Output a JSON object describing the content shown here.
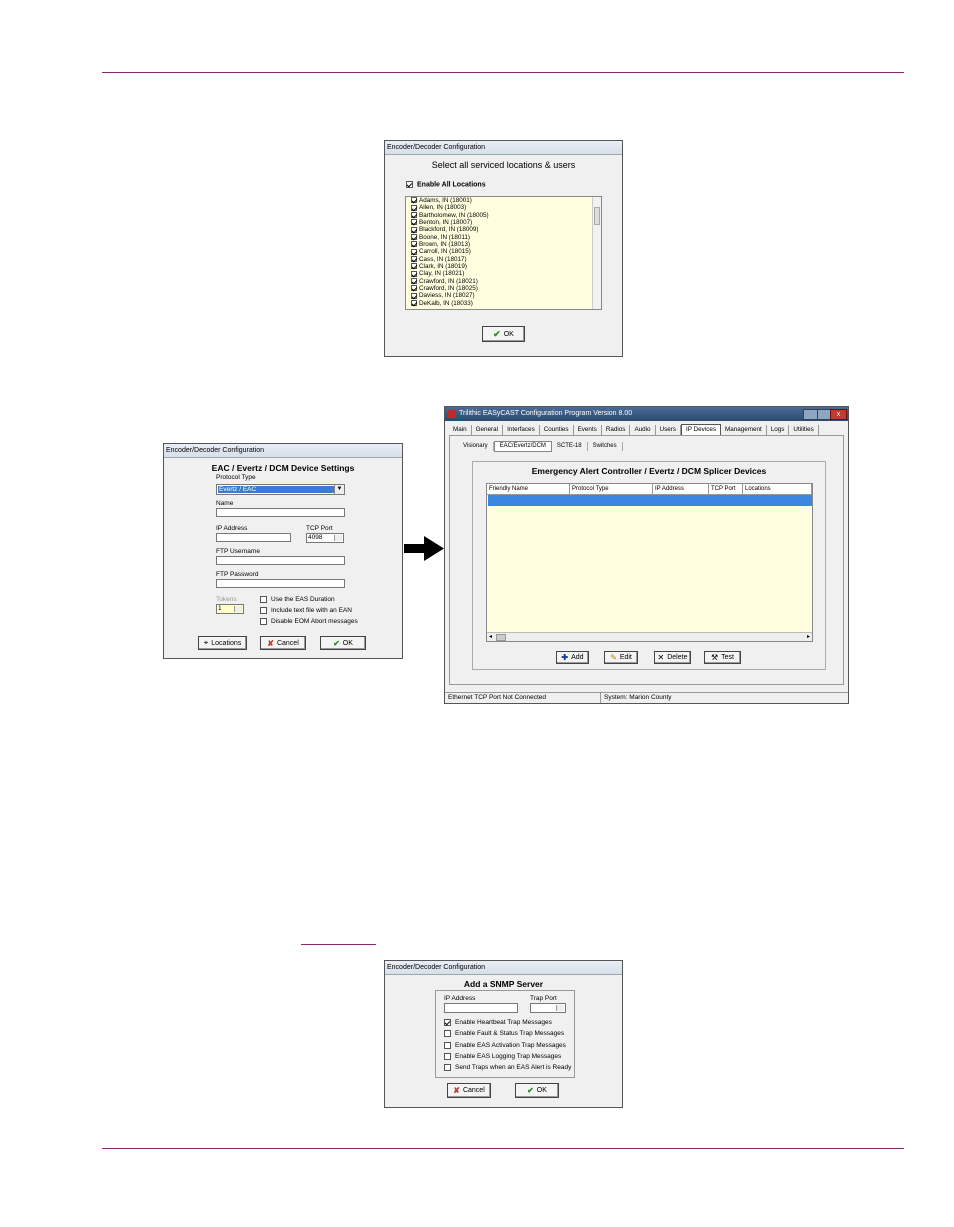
{
  "figure1": {
    "title": "Encoder/Decoder Configuration",
    "heading": "Select all serviced locations & users",
    "enable_all_label": "Enable All Locations",
    "locations": [
      "Adams, IN (18001)",
      "Allen, IN (18003)",
      "Bartholomew, IN (18005)",
      "Benton, IN (18007)",
      "Blackford, IN (18009)",
      "Boone, IN (18011)",
      "Brown, IN (18013)",
      "Carroll, IN (18015)",
      "Cass, IN (18017)",
      "Clark, IN (18019)",
      "Clay, IN (18021)",
      "Crawford, IN (18021)",
      "Crawford, IN (18025)",
      "Daviess, IN (18027)",
      "DeKalb, IN (18033)"
    ],
    "ok_label": "OK"
  },
  "figure2": {
    "title": "Encoder/Decoder Configuration",
    "heading": "EAC / Evertz / DCM Device Settings",
    "protocol_label": "Protocol Type",
    "protocol_value": "Evertz / EAC",
    "name_label": "Name",
    "ip_label": "IP Address",
    "tcp_label": "TCP Port",
    "tcp_value": "4098",
    "ftp_user_label": "FTP Username",
    "ftp_pass_label": "FTP Password",
    "tokens_label": "Tokens",
    "tokens_value": "1",
    "options": [
      "Use the EAS Duration",
      "Include text file with an EAN",
      "Disable EOM Abort messages"
    ],
    "locations_button": "Locations",
    "cancel_button": "Cancel",
    "ok_button": "OK"
  },
  "figure3": {
    "title": "Trilithic EASyCAST Configuration Program Version 8.00",
    "tabs": [
      "Main",
      "General",
      "Interfaces",
      "Counties",
      "Events",
      "Radios",
      "Audio",
      "Users",
      "IP Devices",
      "Management",
      "Logs",
      "Utilities"
    ],
    "subtabs": [
      "Visionary",
      "EAC/Evertz/DCM",
      "SCTE-18",
      "Switches"
    ],
    "panel_title": "Emergency Alert Controller / Evertz / DCM Splicer Devices",
    "columns": [
      "Friendly Name",
      "Protocol Type",
      "IP Address",
      "TCP Port",
      "Locations"
    ],
    "buttons": [
      "Add",
      "Edit",
      "Delete",
      "Test"
    ],
    "status_left": "Ethernet TCP Port Not Connected",
    "status_right": "System: Marion County"
  },
  "figure4": {
    "title": "Encoder/Decoder Configuration",
    "heading": "Add a SNMP Server",
    "ip_label": "IP Address",
    "trap_label": "Trap Port",
    "options": [
      {
        "label": "Enable Heartbeat Trap Messages",
        "checked": true
      },
      {
        "label": "Enable Fault & Status Trap Messages",
        "checked": false
      },
      {
        "label": "Enable EAS Activation Trap Messages",
        "checked": false
      },
      {
        "label": "Enable EAS Logging Trap Messages",
        "checked": false
      },
      {
        "label": "Send Traps when an EAS Alert is Ready",
        "checked": false
      }
    ],
    "cancel_button": "Cancel",
    "ok_button": "OK"
  }
}
